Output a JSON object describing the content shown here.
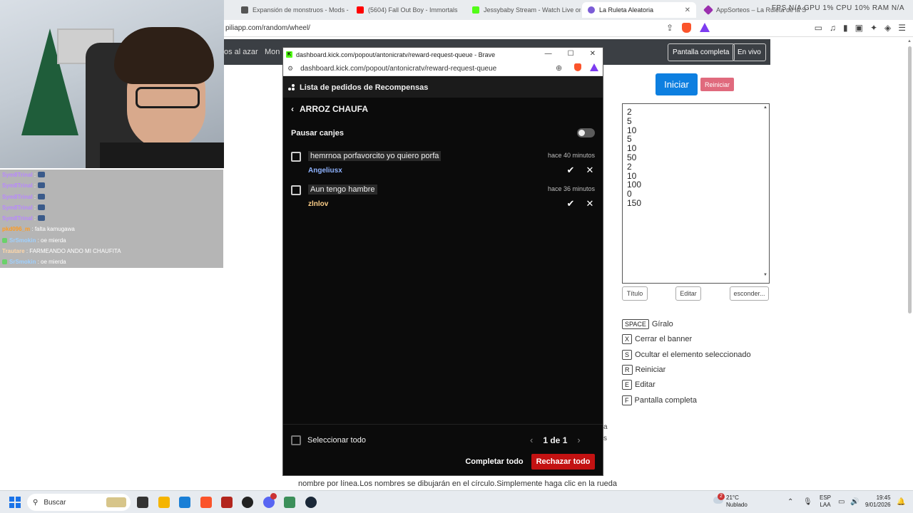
{
  "browser": {
    "tabs": [
      {
        "label": "Expansión de monstruos - Mods - M",
        "color": "#555555"
      },
      {
        "label": "(5604) Fall Out Boy - Immortals",
        "color": "#ff0000"
      },
      {
        "label": "Jessybaby Stream - Watch Live on K",
        "color": "#53fc18"
      },
      {
        "label": "La Ruleta Aleatoria",
        "color": "#7b5cd6"
      },
      {
        "label": "AppSorteos – La Ruleta de la Suerte",
        "color": "#9b2fae"
      }
    ],
    "stats": "FPS N/A   GPU 1%   CPU 10%   RAM N/A",
    "url": "piliapp.com/random/wheel/"
  },
  "site": {
    "nav_item_1": "os al azar",
    "nav_item_2": "Mon",
    "fullscreen_label": "Pantalla completa",
    "live_label": "En vivo",
    "start_label": "Iniciar",
    "reset_label": "Reiniciar",
    "names": [
      "2",
      "5",
      "10",
      "5",
      "10",
      "50",
      "2",
      "10",
      "100",
      "0",
      "150"
    ],
    "title_btn": "Título",
    "edit_btn": "Editar",
    "hide_btn": "esconder...",
    "shortcuts": [
      {
        "key": "SPACE",
        "label": "Gíralo"
      },
      {
        "key": "X",
        "label": "Cerrar el banner"
      },
      {
        "key": "S",
        "label": "Ocultar el elemento seleccionado"
      },
      {
        "key": "R",
        "label": "Reiniciar"
      },
      {
        "key": "E",
        "label": "Editar"
      },
      {
        "key": "F",
        "label": "Pantalla completa"
      }
    ],
    "bottom_text": "nombre por línea.Los nombres se dibujarán en el círculo.Simplemente haga clic en la rueda",
    "peek_a": "a",
    "peek_s": "s"
  },
  "chat": [
    {
      "user": "Sym8Trinal",
      "text": ":",
      "user_color": "#b887ff",
      "badge": false,
      "emote": true
    },
    {
      "user": "Sym8Trinal",
      "text": ":",
      "user_color": "#b887ff",
      "badge": false,
      "emote": true
    },
    {
      "user": "Sym8Trinal",
      "text": ":",
      "user_color": "#b887ff",
      "badge": false,
      "emote": true
    },
    {
      "user": "Sym8Trinal",
      "text": ":",
      "user_color": "#b887ff",
      "badge": false,
      "emote": true
    },
    {
      "user": "Sym8Trinal",
      "text": ":",
      "user_color": "#b887ff",
      "badge": false,
      "emote": true
    },
    {
      "user": "pkd096_m",
      "text": ": falta kamugawa",
      "user_color": "#ff9a1f",
      "badge": false,
      "emote": false
    },
    {
      "user": "SrSmokin",
      "text": ": oe mierda",
      "user_color": "#9ed0ff",
      "badge": true,
      "emote": false
    },
    {
      "user": "Trautare",
      "text": ": FARMEANDO ANDO    MI CHAUFITA",
      "user_color": "#ffd7a8",
      "badge": false,
      "emote": false
    },
    {
      "user": "SrSmokin",
      "text": ": oe mierda",
      "user_color": "#9ed0ff",
      "badge": true,
      "emote": false
    }
  ],
  "popup": {
    "window_title": "dashboard.kick.com/popout/antonicratv/reward-request-queue - Brave",
    "url": "dashboard.kick.com/popout/antonicratv/reward-request-queue",
    "header_title": "Lista de pedidos de Recompensas",
    "reward_name": "ARROZ CHAUFA",
    "pause_label": "Pausar canjes",
    "requests": [
      {
        "message": "hemrnoa porfavorcito yo quiero porfa",
        "time": "hace 40 minutos",
        "user": "Angeliusx",
        "user_color": "#8fb3ff"
      },
      {
        "message": "Aun tengo hambre",
        "time": "hace 36 minutos",
        "user": "zlnlov",
        "user_color": "#ffd089"
      }
    ],
    "select_all_label": "Seleccionar todo",
    "page_info": "1 de 1",
    "complete_all_label": "Completar todo",
    "reject_all_label": "Rechazar todo"
  },
  "taskbar": {
    "search_placeholder": "Buscar",
    "weather_temp": "21°C",
    "weather_desc": "Nublado",
    "weather_badge": "2",
    "lang_1": "ESP",
    "lang_2": "LAA",
    "time": "19:45",
    "date": "9/01/2026"
  }
}
